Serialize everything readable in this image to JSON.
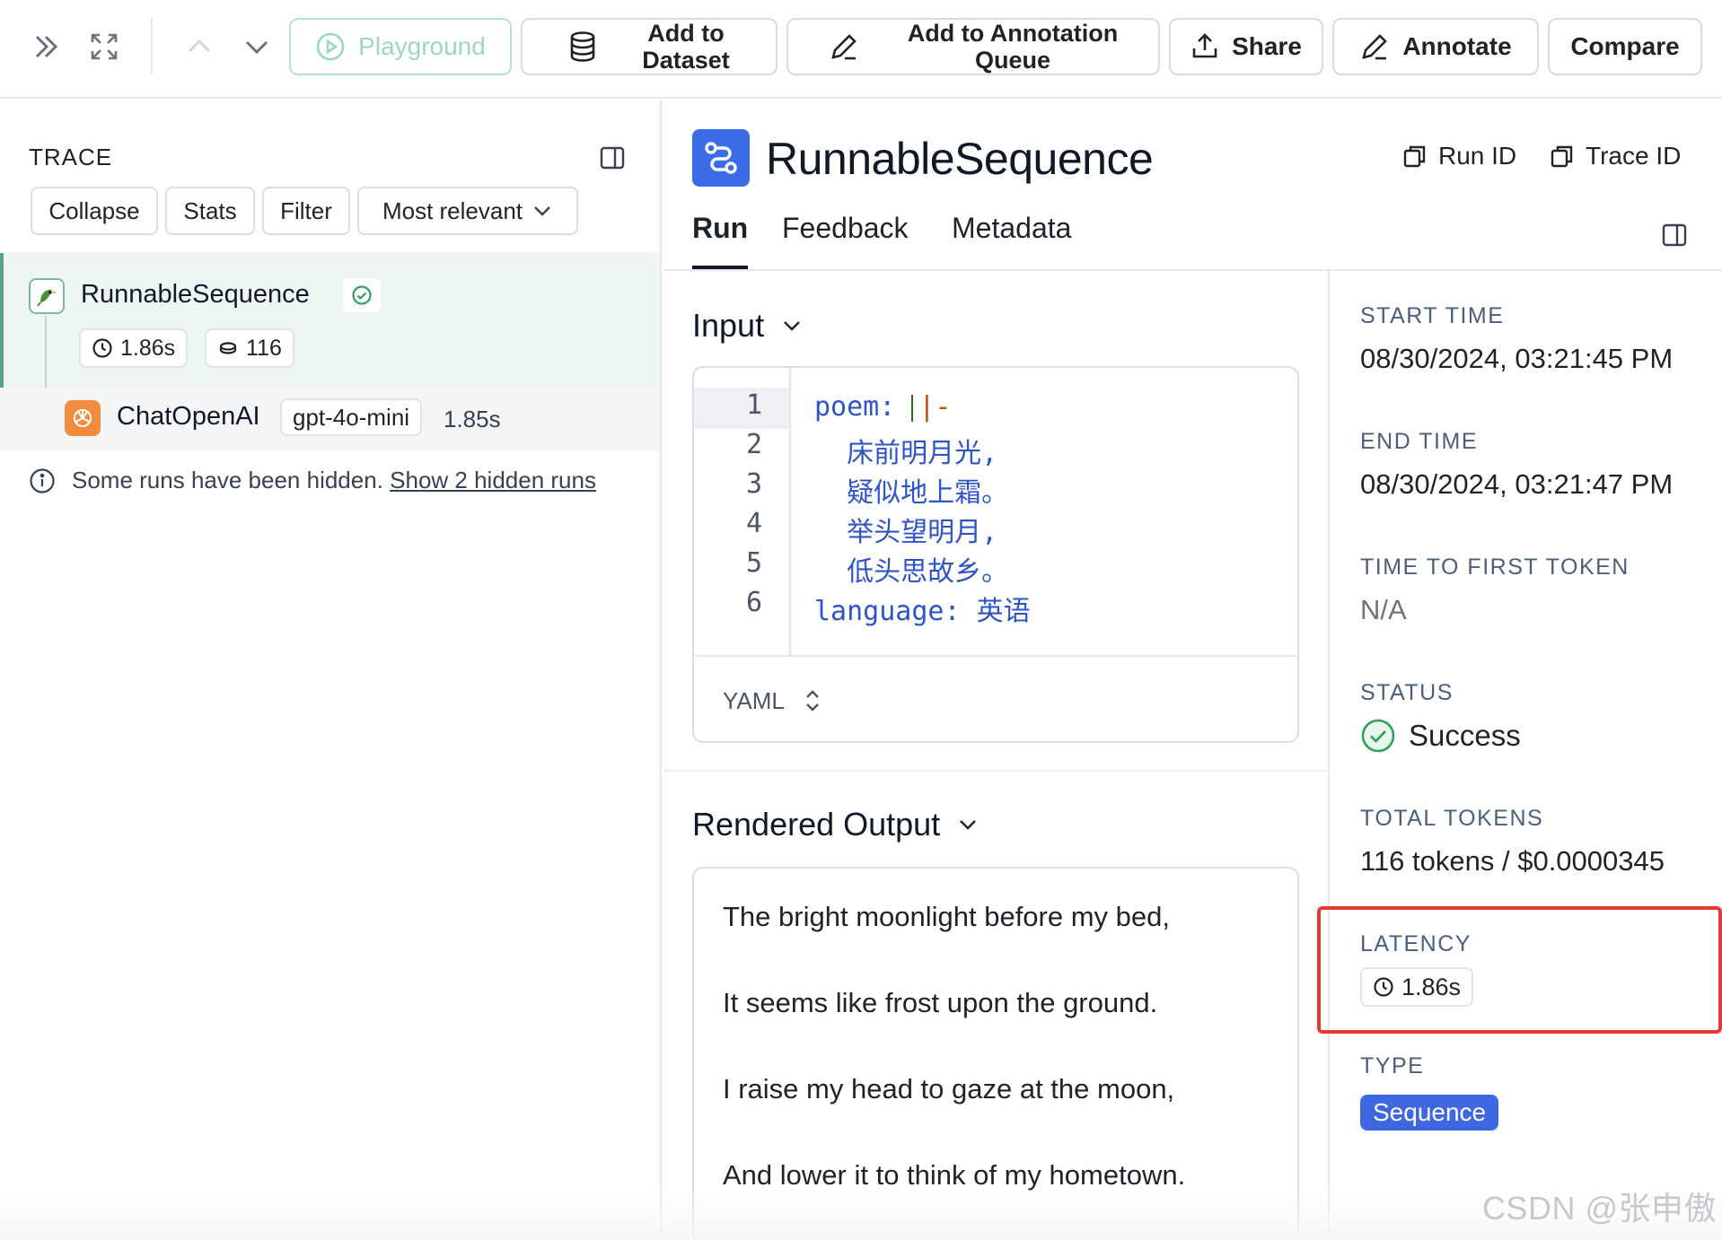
{
  "toolbar": {
    "playground_label": "Playground",
    "add_dataset_label": "Add to\nDataset",
    "add_dataset_line1": "Add to",
    "add_dataset_line2": "Dataset",
    "annotation_queue_line1": "Add to Annotation",
    "annotation_queue_line2": "Queue",
    "share_label": "Share",
    "annotate_label": "Annotate",
    "compare_label": "Compare"
  },
  "trace": {
    "title": "TRACE",
    "controls": [
      "Collapse",
      "Stats",
      "Filter",
      "Most relevant"
    ],
    "root": {
      "name": "RunnableSequence",
      "latency": "1.86s",
      "tokens": "116"
    },
    "child": {
      "name": "ChatOpenAI",
      "model": "gpt-4o-mini",
      "latency": "1.85s"
    },
    "hidden_note": "Some runs have been hidden.",
    "hidden_link": "Show 2 hidden runs"
  },
  "run": {
    "title": "RunnableSequence",
    "run_id_label": "Run ID",
    "trace_id_label": "Trace ID",
    "tabs": [
      "Run",
      "Feedback",
      "Metadata"
    ]
  },
  "input": {
    "title": "Input",
    "line_numbers": [
      "1",
      "2",
      "3",
      "4",
      "5",
      "6"
    ],
    "lines": [
      "poem: ",
      "  床前明月光,",
      "  疑似地上霜。",
      "  举头望明月,",
      "  低头思故乡。",
      "language: 英语"
    ],
    "line1_op": "|-",
    "format": "YAML"
  },
  "output": {
    "title": "Rendered Output",
    "lines": [
      "The bright moonlight before my bed,",
      "It seems like frost upon the ground.",
      "I raise my head to gaze at the moon,",
      "And lower it to think of my hometown."
    ]
  },
  "meta": {
    "start_time_label": "START TIME",
    "start_time": "08/30/2024, 03:21:45 PM",
    "end_time_label": "END TIME",
    "end_time": "08/30/2024, 03:21:47 PM",
    "ttft_label": "TIME TO FIRST TOKEN",
    "ttft": "N/A",
    "status_label": "STATUS",
    "status": "Success",
    "tokens_label": "TOTAL TOKENS",
    "tokens": "116 tokens / $0.0000345",
    "latency_label": "LATENCY",
    "latency": "1.86s",
    "type_label": "TYPE",
    "type": "Sequence"
  },
  "colors": {
    "accent": "#3f68e0",
    "success": "#2e9e5b",
    "highlight": "#e53935",
    "playground": "#9fd6c2"
  },
  "watermark": "CSDN @张申傲"
}
